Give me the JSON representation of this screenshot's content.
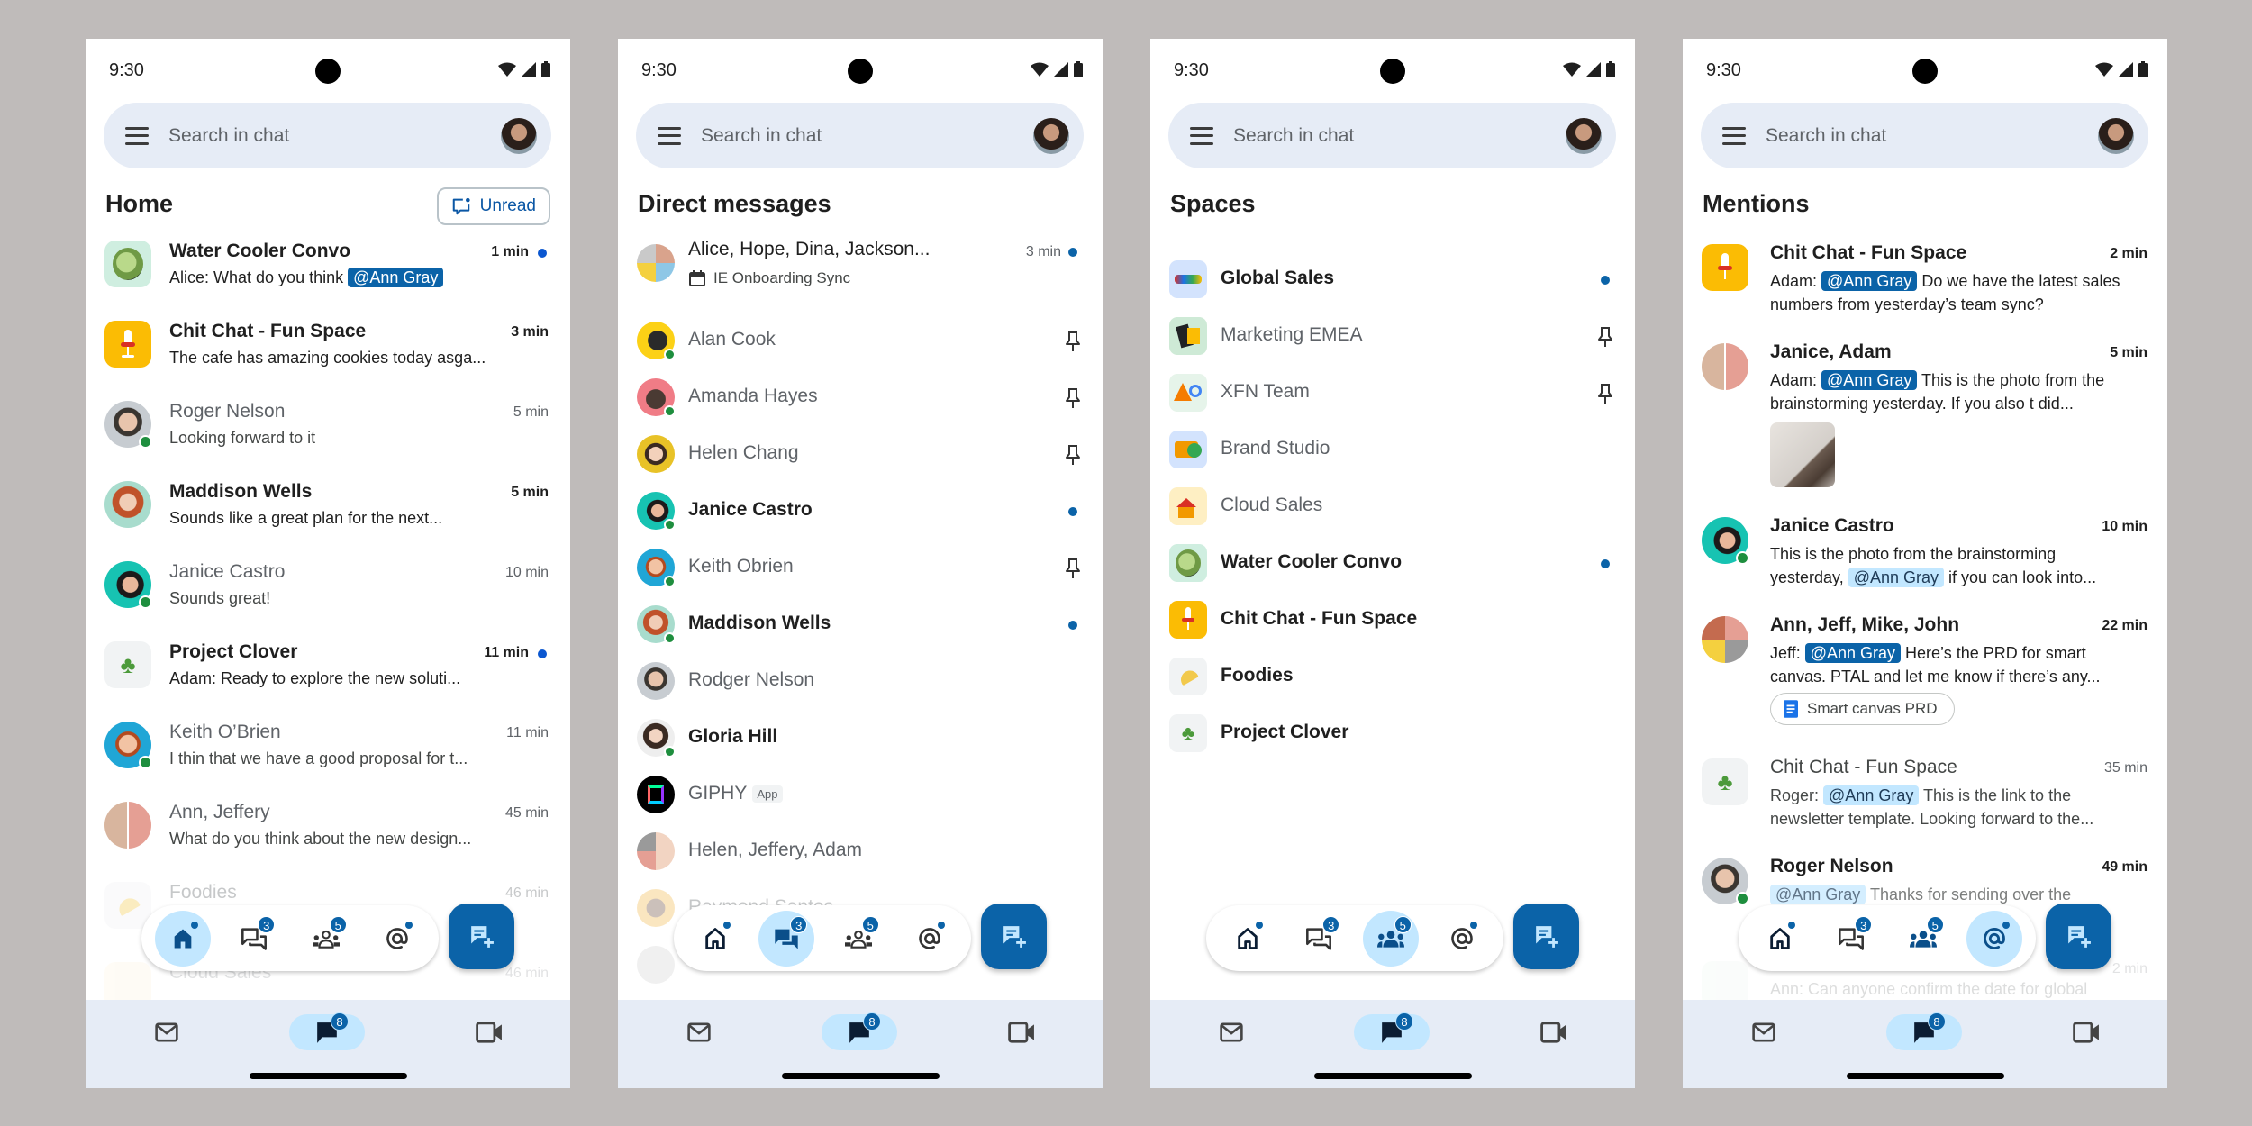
{
  "status_bar": {
    "time": "9:30"
  },
  "search": {
    "placeholder": "Search in chat"
  },
  "floating_nav": {
    "items": [
      {
        "name": "home",
        "badge": null,
        "dot": true
      },
      {
        "name": "direct-messages",
        "badge": "3",
        "dot": false
      },
      {
        "name": "spaces",
        "badge": "5",
        "dot": false
      },
      {
        "name": "mentions",
        "badge": null,
        "dot": true
      }
    ],
    "fab_label": "New chat"
  },
  "bottom_nav": {
    "items": [
      {
        "name": "Mail"
      },
      {
        "name": "Chat",
        "badge": "8",
        "active": true
      },
      {
        "name": "Meet"
      }
    ]
  },
  "colors": {
    "accent": "#0b63a8",
    "active_pill": "#c2e7ff",
    "search_bg": "#e6ecf6",
    "online": "#1e8e3e",
    "backdrop": "#bfbbba"
  },
  "screens": {
    "home": {
      "title": "Home",
      "unread_button": "Unread",
      "active_nav": "home",
      "items": [
        {
          "name": "Water Cooler Convo",
          "prefix": "Alice: What do you think ",
          "mention": "@Ann Gray",
          "suffix": "",
          "time": "1 min",
          "unread": true,
          "bold": true
        },
        {
          "name": "Chit Chat - Fun Space",
          "snippet": "The cafe has amazing cookies today asga...",
          "time": "3 min",
          "unread": false,
          "bold": true
        },
        {
          "name": "Roger Nelson",
          "snippet": "Looking forward to it",
          "time": "5 min",
          "unread": false,
          "bold": false,
          "online": true
        },
        {
          "name": "Maddison Wells",
          "snippet": "Sounds like a great plan for the next...",
          "time": "5 min",
          "unread": false,
          "bold": true
        },
        {
          "name": "Janice Castro",
          "snippet": "Sounds great!",
          "time": "10 min",
          "unread": false,
          "bold": false,
          "online": true
        },
        {
          "name": "Project Clover",
          "snippet": "Adam: Ready to explore the new soluti...",
          "time": "11 min",
          "unread": true,
          "bold": true
        },
        {
          "name": "Keith O’Brien",
          "snippet": "I thin that we have a good proposal for t...",
          "time": "11 min",
          "unread": false,
          "bold": false,
          "online": true
        },
        {
          "name": "Ann, Jeffery",
          "snippet": "What do you think about the new design...",
          "time": "45 min",
          "unread": false,
          "bold": false
        },
        {
          "name": "Foodies",
          "snippet": "",
          "time": "46 min",
          "unread": false,
          "bold": false
        },
        {
          "name": "Cloud Sales",
          "snippet": "",
          "time": "46 min",
          "unread": false,
          "bold": false
        }
      ]
    },
    "dms": {
      "title": "Direct messages",
      "active_nav": "direct-messages",
      "group": {
        "name": "Alice, Hope, Dina, Jackson...",
        "time": "3 min",
        "event": "IE Onboarding Sync",
        "unread": true
      },
      "items": [
        {
          "name": "Alan Cook",
          "bold": false,
          "pinned": true,
          "unread": false,
          "online": true
        },
        {
          "name": "Amanda Hayes",
          "bold": false,
          "pinned": true,
          "unread": false,
          "online": true
        },
        {
          "name": "Helen Chang",
          "bold": false,
          "pinned": true,
          "unread": false,
          "online": false
        },
        {
          "name": "Janice Castro",
          "bold": true,
          "pinned": false,
          "unread": true,
          "online": true
        },
        {
          "name": "Keith Obrien",
          "bold": false,
          "pinned": true,
          "unread": false,
          "online": true
        },
        {
          "name": "Maddison Wells",
          "bold": true,
          "pinned": false,
          "unread": true,
          "online": true
        },
        {
          "name": "Rodger Nelson",
          "bold": false,
          "pinned": false,
          "unread": false,
          "online": false
        },
        {
          "name": "Gloria Hill",
          "bold": true,
          "pinned": false,
          "unread": false,
          "online": true
        },
        {
          "name": "GIPHY",
          "tag": "App",
          "bold": false,
          "pinned": false,
          "unread": false,
          "online": false
        },
        {
          "name": "Helen, Jeffery, Adam",
          "bold": false,
          "pinned": false,
          "unread": false,
          "online": false
        },
        {
          "name": "Raymond Santos",
          "bold": false,
          "pinned": false,
          "unread": false,
          "online": false
        }
      ]
    },
    "spaces": {
      "title": "Spaces",
      "active_nav": "spaces",
      "items": [
        {
          "name": "Global Sales",
          "bold": true,
          "unread": true,
          "pinned": false
        },
        {
          "name": "Marketing EMEA",
          "bold": false,
          "unread": false,
          "pinned": true
        },
        {
          "name": "XFN Team",
          "bold": false,
          "unread": false,
          "pinned": true
        },
        {
          "name": "Brand Studio",
          "bold": false,
          "unread": false,
          "pinned": false
        },
        {
          "name": "Cloud Sales",
          "bold": false,
          "unread": false,
          "pinned": false
        },
        {
          "name": "Water Cooler Convo",
          "bold": true,
          "unread": true,
          "pinned": false
        },
        {
          "name": "Chit Chat - Fun Space",
          "bold": true,
          "unread": false,
          "pinned": false
        },
        {
          "name": "Foodies",
          "bold": true,
          "unread": false,
          "pinned": false
        },
        {
          "name": "Project Clover",
          "bold": true,
          "unread": false,
          "pinned": false
        }
      ]
    },
    "mentions": {
      "title": "Mentions",
      "active_nav": "mentions",
      "items": [
        {
          "name": "Chit Chat - Fun Space",
          "time": "2 min",
          "sender": "Adam: ",
          "mention": "@Ann Gray",
          "text": " Do we have the latest sales numbers from yesterday’s team sync?",
          "read": false
        },
        {
          "name": "Janice, Adam",
          "time": "5 min",
          "sender": "Adam: ",
          "mention": "@Ann Gray",
          "text": " This is the photo from the brainstorming yesterday. If you also t  did...",
          "read": false,
          "attachment": "photo"
        },
        {
          "name": "Janice Castro",
          "time": "10 min",
          "sender": "This is the photo from the brainstorming yesterday, ",
          "mention": "@Ann Gray",
          "text": " if you can look into...",
          "read": false,
          "mention_style": "light"
        },
        {
          "name": "Ann, Jeff, Mike, John",
          "time": "22 min",
          "sender": "Jeff: ",
          "mention": "@Ann Gray",
          "text": " Here’s the PRD for smart canvas. PTAL and let me know if there’s any...",
          "read": false,
          "chip": "Smart canvas PRD"
        },
        {
          "name": "Chit Chat - Fun Space",
          "time": "35 min",
          "sender": "Roger: ",
          "mention": "@Ann Gray",
          "text": " This is the link to the newsletter template. Looking forward to the...",
          "read": true
        },
        {
          "name": "Roger Nelson",
          "time": "49 min",
          "sender": "",
          "mention": "@Ann Gray",
          "text": " Thanks for sending over the",
          "read": false
        },
        {
          "name": "",
          "time": "2 min",
          "sender": "Ann: Can anyone confirm the date for global",
          "mention": "",
          "text": "",
          "read": true
        }
      ]
    }
  }
}
